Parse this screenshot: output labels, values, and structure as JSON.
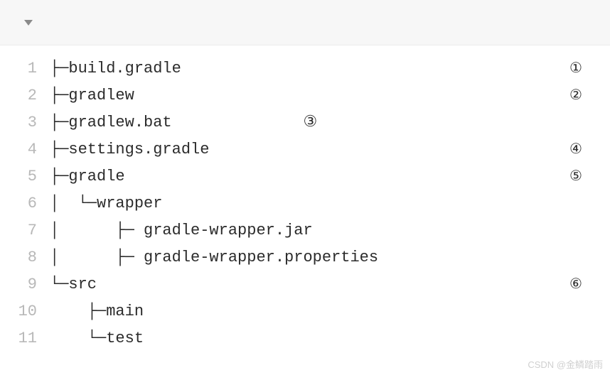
{
  "lines": [
    {
      "n": 1,
      "text": "├─build.gradle",
      "marker": "①"
    },
    {
      "n": 2,
      "text": "├─gradlew",
      "marker": "②"
    },
    {
      "n": 3,
      "text": "├─gradlew.bat              ③",
      "marker": ""
    },
    {
      "n": 4,
      "text": "├─settings.gradle",
      "marker": "④"
    },
    {
      "n": 5,
      "text": "├─gradle",
      "marker": "⑤"
    },
    {
      "n": 6,
      "text": "│  └─wrapper",
      "marker": ""
    },
    {
      "n": 7,
      "text": "│      ├─ gradle-wrapper.jar",
      "marker": ""
    },
    {
      "n": 8,
      "text": "│      ├─ gradle-wrapper.properties",
      "marker": ""
    },
    {
      "n": 9,
      "text": "└─src",
      "marker": "⑥"
    },
    {
      "n": 10,
      "text": "    ├─main",
      "marker": ""
    },
    {
      "n": 11,
      "text": "    └─test",
      "marker": ""
    }
  ],
  "watermark": "CSDN @金鳞踏雨"
}
